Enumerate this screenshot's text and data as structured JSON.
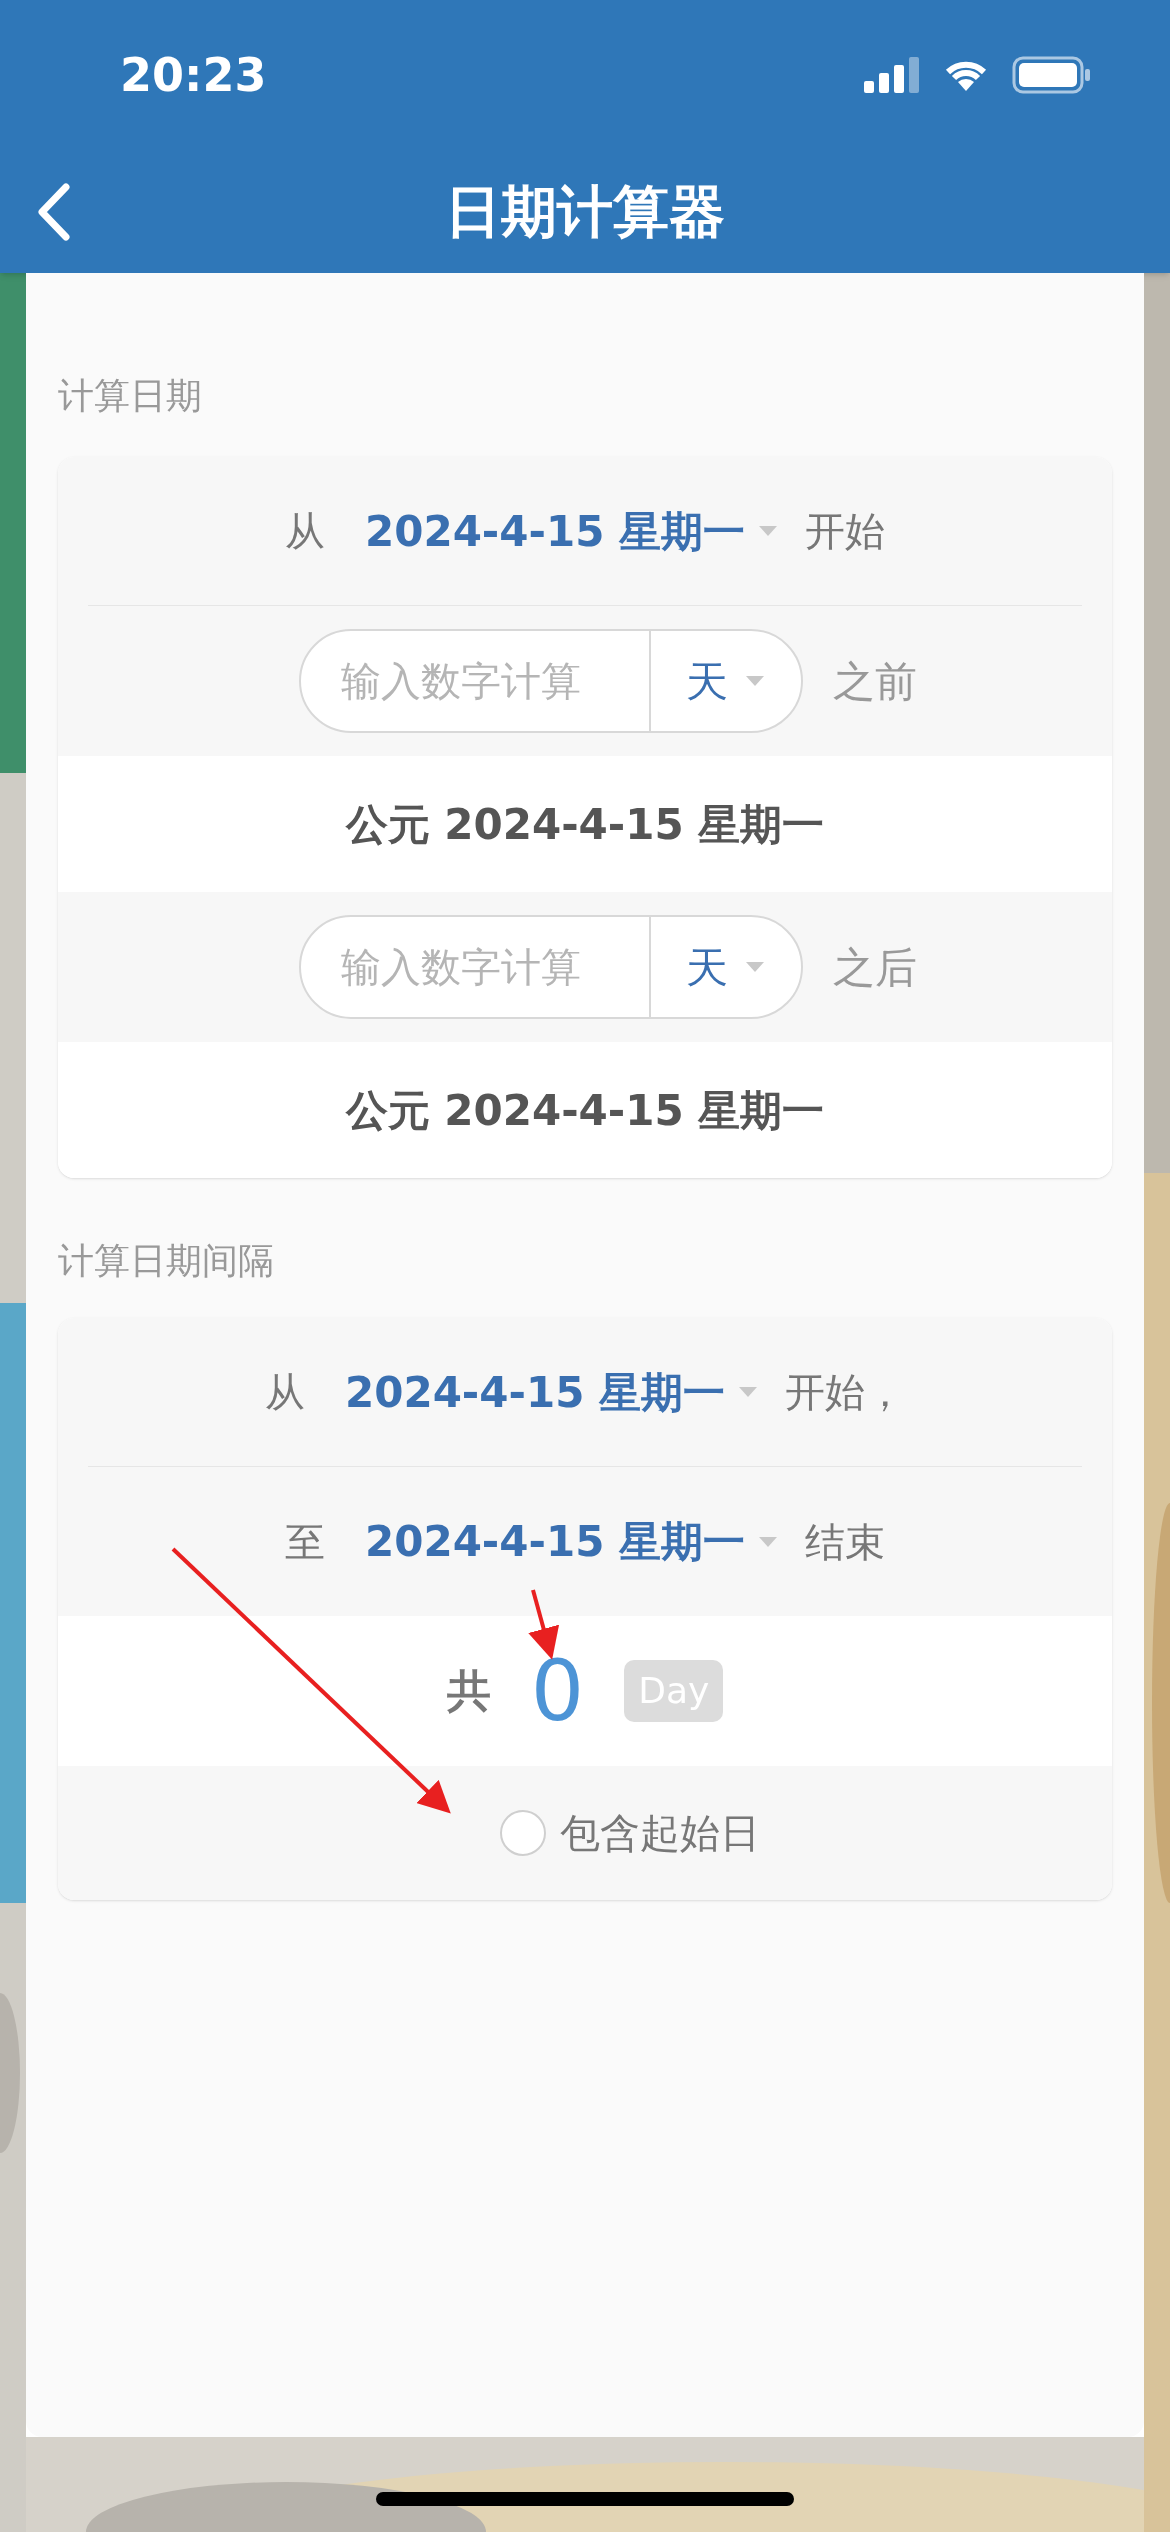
{
  "status_bar": {
    "time": "20:23"
  },
  "nav": {
    "title": "日期计算器"
  },
  "date_calc": {
    "label": "计算日期",
    "from": {
      "prefix": "从",
      "date": "2024-4-15 星期一",
      "suffix": "开始"
    },
    "rows": [
      {
        "placeholder": "输入数字计算",
        "unit": "天",
        "suffix": "之前",
        "result": "公元 2024-4-15 星期一"
      },
      {
        "placeholder": "输入数字计算",
        "unit": "天",
        "suffix": "之后",
        "result": "公元 2024-4-15 星期一"
      }
    ]
  },
  "interval": {
    "label": "计算日期间隔",
    "dates": [
      {
        "prefix": "从",
        "date": "2024-4-15 星期一",
        "suffix": "开始，"
      },
      {
        "prefix": "至",
        "date": "2024-4-15 星期一",
        "suffix": "结束"
      }
    ],
    "total": {
      "prefix": "共",
      "value": "0",
      "unit": "Day"
    },
    "include_start": {
      "label": "包含起始日",
      "checked": false
    }
  }
}
